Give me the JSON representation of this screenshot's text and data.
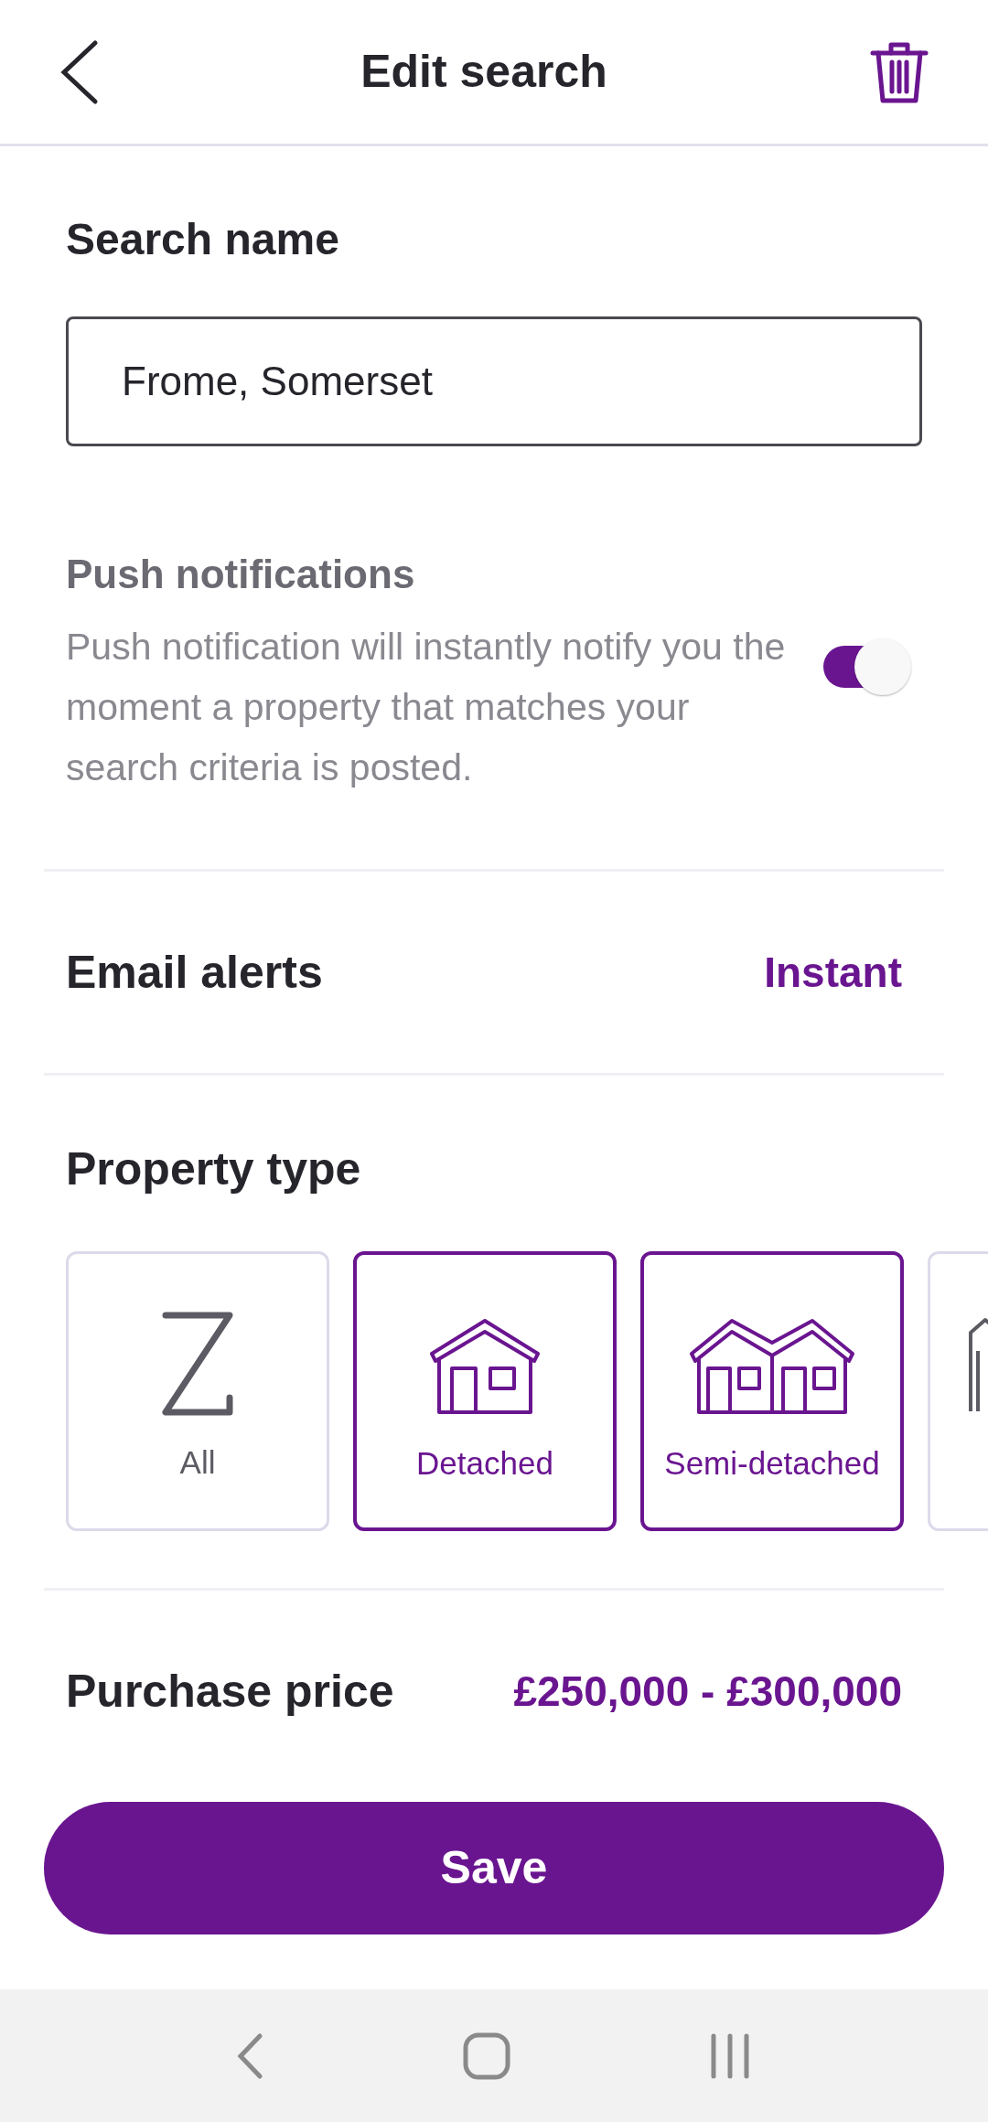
{
  "header": {
    "title": "Edit search"
  },
  "search_name": {
    "label": "Search name",
    "value": "Frome, Somerset"
  },
  "push_notifications": {
    "label": "Push notifications",
    "description": "Push notification will instantly notify you the moment a property that matches your search criteria is posted.",
    "on": true
  },
  "email_alerts": {
    "label": "Email alerts",
    "value": "Instant"
  },
  "property_type": {
    "label": "Property type",
    "options": [
      {
        "kind": "all",
        "label": "All",
        "selected": false
      },
      {
        "kind": "detached",
        "label": "Detached",
        "selected": true
      },
      {
        "kind": "semi",
        "label": "Semi-detached",
        "selected": true
      },
      {
        "kind": "terraced",
        "selected": false
      }
    ]
  },
  "purchase_price": {
    "label": "Purchase price",
    "value": "£250,000 - £300,000"
  },
  "save_button": {
    "label": "Save"
  }
}
